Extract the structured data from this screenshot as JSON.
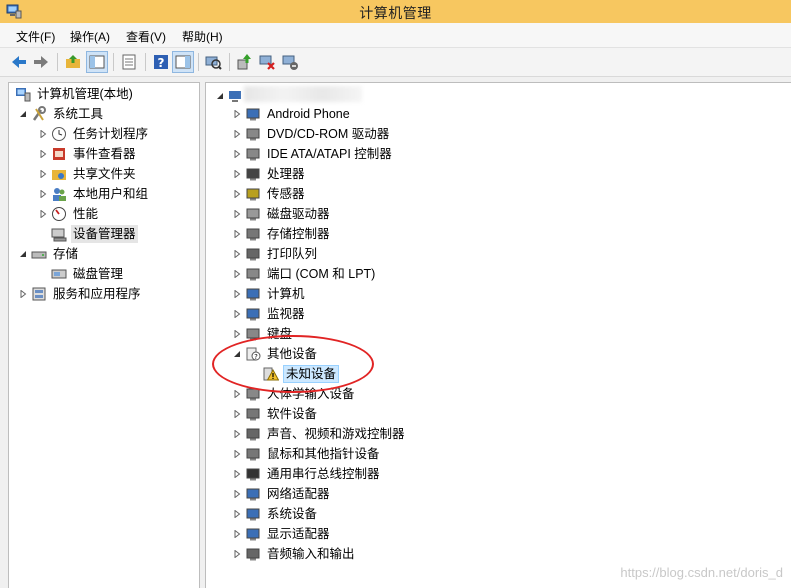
{
  "window": {
    "title": "计算机管理"
  },
  "menu": [
    "文件(F)",
    "操作(A)",
    "查看(V)",
    "帮助(H)"
  ],
  "toolbar": {
    "buttons": [
      "back-icon",
      "forward-icon",
      "up-folder-icon",
      "show-hide-tree-icon",
      "properties-icon",
      "help-icon",
      "action-pane-icon",
      "scan-hardware-icon",
      "update-driver-icon",
      "disable-device-icon",
      "uninstall-device-icon"
    ]
  },
  "left_tree": [
    {
      "label": "计算机管理(本地)"
    },
    {
      "label": "系统工具"
    },
    {
      "label": "任务计划程序"
    },
    {
      "label": "事件查看器"
    },
    {
      "label": "共享文件夹"
    },
    {
      "label": "本地用户和组"
    },
    {
      "label": "性能"
    },
    {
      "label": "设备管理器"
    },
    {
      "label": "存储"
    },
    {
      "label": "磁盘管理"
    },
    {
      "label": "服务和应用程序"
    }
  ],
  "device_tree": [
    {
      "label": "Android Phone"
    },
    {
      "label": "DVD/CD-ROM 驱动器"
    },
    {
      "label": "IDE ATA/ATAPI 控制器"
    },
    {
      "label": "处理器"
    },
    {
      "label": "传感器"
    },
    {
      "label": "磁盘驱动器"
    },
    {
      "label": "存储控制器"
    },
    {
      "label": "打印队列"
    },
    {
      "label": "端口 (COM 和 LPT)"
    },
    {
      "label": "计算机"
    },
    {
      "label": "监视器"
    },
    {
      "label": "键盘"
    },
    {
      "label": "其他设备"
    },
    {
      "label": "未知设备"
    },
    {
      "label": "人体学输入设备"
    },
    {
      "label": "软件设备"
    },
    {
      "label": "声音、视频和游戏控制器"
    },
    {
      "label": "鼠标和其他指针设备"
    },
    {
      "label": "通用串行总线控制器"
    },
    {
      "label": "网络适配器"
    },
    {
      "label": "系统设备"
    },
    {
      "label": "显示适配器"
    },
    {
      "label": "音频输入和输出"
    }
  ],
  "watermark": "https://blog.csdn.net/doris_d",
  "colors": {
    "titlebar": "#f7c760",
    "highlight": "#cce8ff",
    "annotation": "#e12424"
  }
}
